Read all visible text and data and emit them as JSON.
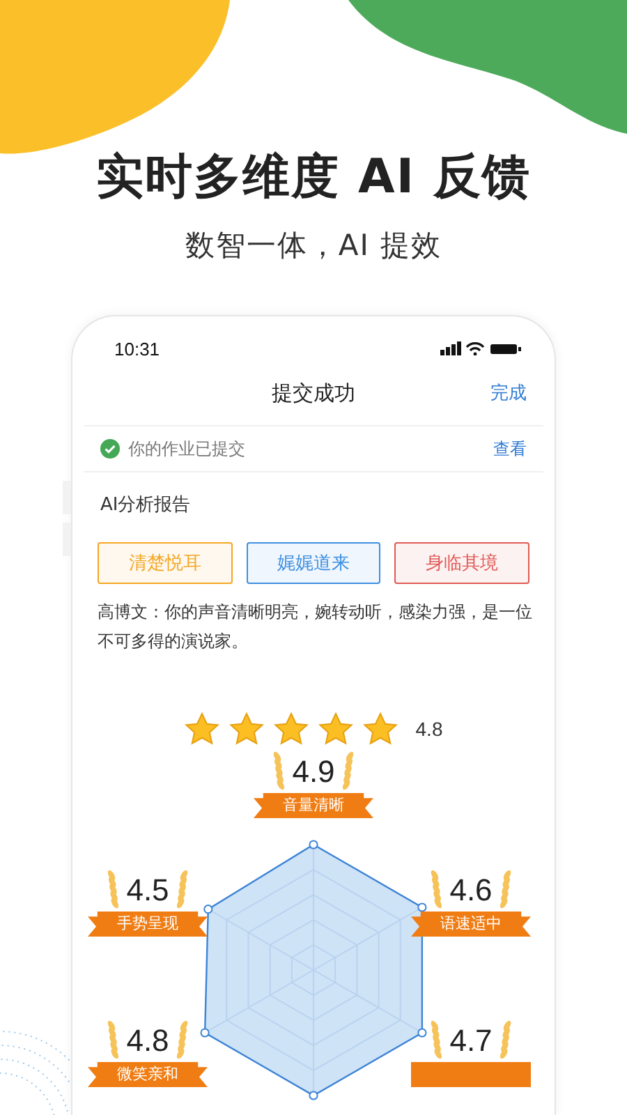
{
  "headline": "实时多维度 AI 反馈",
  "subtitle": "数智一体，AI 提效",
  "phone": {
    "status_bar": {
      "time": "10:31"
    },
    "nav": {
      "title": "提交成功",
      "action": "完成"
    },
    "notice": {
      "text": "你的作业已提交",
      "link": "查看"
    },
    "report": {
      "title": "AI分析报告",
      "tags": [
        {
          "label": "清楚悦耳",
          "color": "#f5a623"
        },
        {
          "label": "娓娓道来",
          "color": "#3d8fe0"
        },
        {
          "label": "身临其境",
          "color": "#e05a55"
        }
      ],
      "comment": "高博文：你的声音清晰明亮，婉转动听，感染力强，是一位不可多得的演说家。",
      "stars": 5,
      "score": "4.8",
      "metrics": [
        {
          "score": "4.9",
          "label": "音量清晰"
        },
        {
          "score": "4.5",
          "label": "手势呈现"
        },
        {
          "score": "4.6",
          "label": "语速适中"
        },
        {
          "score": "4.8",
          "label": "微笑亲和"
        },
        {
          "score": "4.7"
        }
      ]
    }
  }
}
